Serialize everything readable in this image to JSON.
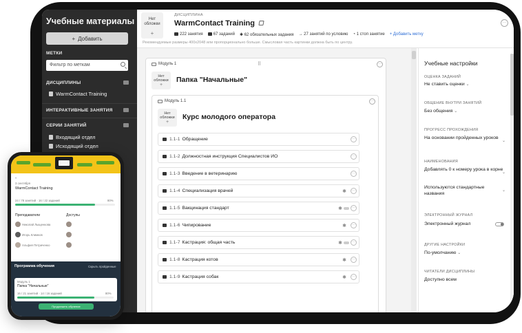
{
  "sidebar": {
    "title": "Учебные материалы",
    "add_label": "Добавить",
    "tags_label": "МЕТКИ",
    "filter_placeholder": "Фильтр по меткам",
    "disciplines_label": "ДИСЦИПЛИНЫ",
    "disciplines": [
      "WarmContact Training"
    ],
    "interactive_label": "ИНТЕРАКТИВНЫЕ ЗАНЯТИЯ",
    "series_label": "СЕРИИ ЗАНЯТИЙ",
    "series": [
      "Входящий отдел",
      "Исходящий отдел"
    ]
  },
  "header": {
    "cover_text": "Нет обложки",
    "discipline_label": "ДИСЦИПЛИНА",
    "title": "WarmContact Training",
    "stats": [
      "222 занятия",
      "67 заданий",
      "62 обязательных задания",
      "27 занятий по условию",
      "1 стоп занятие"
    ],
    "add_tag": "+ Добавить метку",
    "hint": "Рекомендуемые размеры 400x2048 или пропорционально больше. Смысловая часть картинки должна быть по центру.",
    "more": "···"
  },
  "module": {
    "label": "Модуль 1",
    "cover_text": "Нет обложки",
    "title": "Папка \"Начальные\"",
    "sub_label": "Модуль 1.1",
    "sub_title": "Курс молодого оператора",
    "lessons": [
      {
        "num": "1.1-1",
        "name": "Обращение",
        "star": false,
        "toggle": false
      },
      {
        "num": "1.1-2",
        "name": "Должностная инструкция Специалистов ИО",
        "star": false,
        "toggle": false
      },
      {
        "num": "1.1-3",
        "name": "Введение в ветеринарию",
        "star": false,
        "toggle": false
      },
      {
        "num": "1.1-4",
        "name": "Специализация врачей",
        "star": true,
        "toggle": false
      },
      {
        "num": "1.1-5",
        "name": "Вакцинация стандарт",
        "star": true,
        "toggle": true
      },
      {
        "num": "1.1-6",
        "name": "Чипирование",
        "star": true,
        "toggle": false
      },
      {
        "num": "1.1-7",
        "name": "Кастрация: общая часть",
        "star": true,
        "toggle": true
      },
      {
        "num": "1.1-8",
        "name": "Кастрация котов",
        "star": true,
        "toggle": false
      },
      {
        "num": "1.1-9",
        "name": "Кастрация собак",
        "star": true,
        "toggle": false
      }
    ]
  },
  "settings": {
    "title": "Учебные настройки",
    "groups": [
      {
        "label": "ОЦЕНКА ЗАДАНИЙ",
        "value": "Не ставить оценки"
      },
      {
        "label": "ОБЩЕНИЕ ВНУТРИ ЗАНЯТИЙ",
        "value": "Без общения"
      },
      {
        "label": "ПРОГРЕСС ПРОХОЖДЕНИЯ",
        "value": "На основании пройденных уроков"
      },
      {
        "label": "НАИМЕНОВАНИЯ",
        "value": "Добавлять 0 к номеру урока в корне",
        "value2": "Используются стандартные названия"
      },
      {
        "label": "ЭЛЕКТРОННЫЙ ЖУРНАЛ",
        "value": "Электронный журнал"
      },
      {
        "label": "ДРУГИЕ НАСТРОЙКИ",
        "value": "По-умолчанию"
      },
      {
        "label": "ЧИТАТЕЛИ ДИСЦИПЛИНЫ",
        "value": "Доступно всем"
      }
    ]
  },
  "phone": {
    "course_small": "3 сентября",
    "course_title": "WarmContact Training",
    "course_stats": "24 / 78 занятий · 16 / 22 заданий",
    "course_percent": "80%",
    "course_progress": 0.8,
    "teachers_label": "Преподаватели",
    "teachers": [
      "Николай Лыщенкова",
      "Игорь Климков",
      "Альфия Петриченко"
    ],
    "access_label": "Доступы",
    "program_label": "Программа обучения",
    "program_link": "Скрыть пройденные",
    "card_small": "Модуль 1",
    "card_title": "Папка \"Начальные\"",
    "card_stats": "16 / 21 занятий · 14 / 16 заданий",
    "card_percent": "80%",
    "card_progress": 0.8,
    "cta": "Продолжить обучение",
    "colors": {
      "banner": "#f3c318",
      "accent": "#3bb273",
      "dark": "#23313f"
    }
  }
}
